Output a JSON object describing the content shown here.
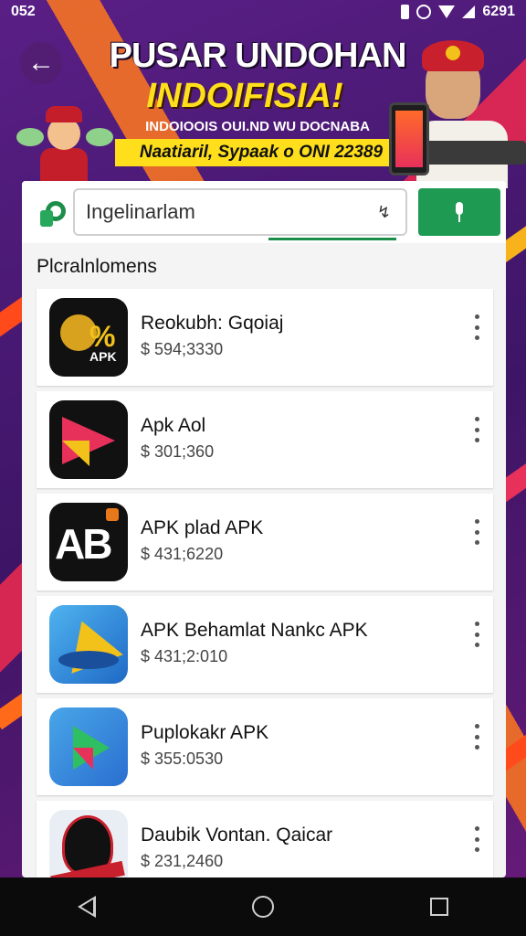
{
  "status_bar": {
    "left_text": "052",
    "right_text": "6291",
    "icons": [
      "notification-icon",
      "sync-icon",
      "wifi-icon",
      "signal-icon",
      "battery-icon"
    ]
  },
  "banner": {
    "title": "PUSAR UNDOHAN",
    "headline": "INDOIFISIA!",
    "subtitle": "INDOIOOIS OUI.ND WU DOCNABA",
    "strip_text": "Naatiaril, Sypaak o ONI 22389"
  },
  "search": {
    "value": "Ingelinarlam",
    "voice_small_icon": "voice-wave-icon"
  },
  "section_title": "Plcralnlomens",
  "apps": [
    {
      "name": "Reokubh: Gqoiaj",
      "size": "$ 594;3330",
      "icon": "garuda-apk-icon",
      "icon_label": "APK",
      "icon_symbol": "%"
    },
    {
      "name": "Apk Aol",
      "size": "$ 301;360",
      "icon": "triangle-play-icon"
    },
    {
      "name": "APK plad APK",
      "size": "$ 431;6220",
      "icon": "ab-logo-icon",
      "icon_text": "AB"
    },
    {
      "name": "APK Behamlat Nankc APK",
      "size": "$ 431;2:010",
      "icon": "paper-plane-icon"
    },
    {
      "name": "Puplokakr APK",
      "size": "$ 355:0530",
      "icon": "play-store-icon"
    },
    {
      "name": "Daubik Vontan. Qaicar",
      "size": "$ 231,2460",
      "icon": "shield-emblem-icon"
    }
  ],
  "colors": {
    "accent_green": "#1e9a52",
    "banner_yellow": "#ffdf1c",
    "background_purple": "#4a1a6e"
  }
}
